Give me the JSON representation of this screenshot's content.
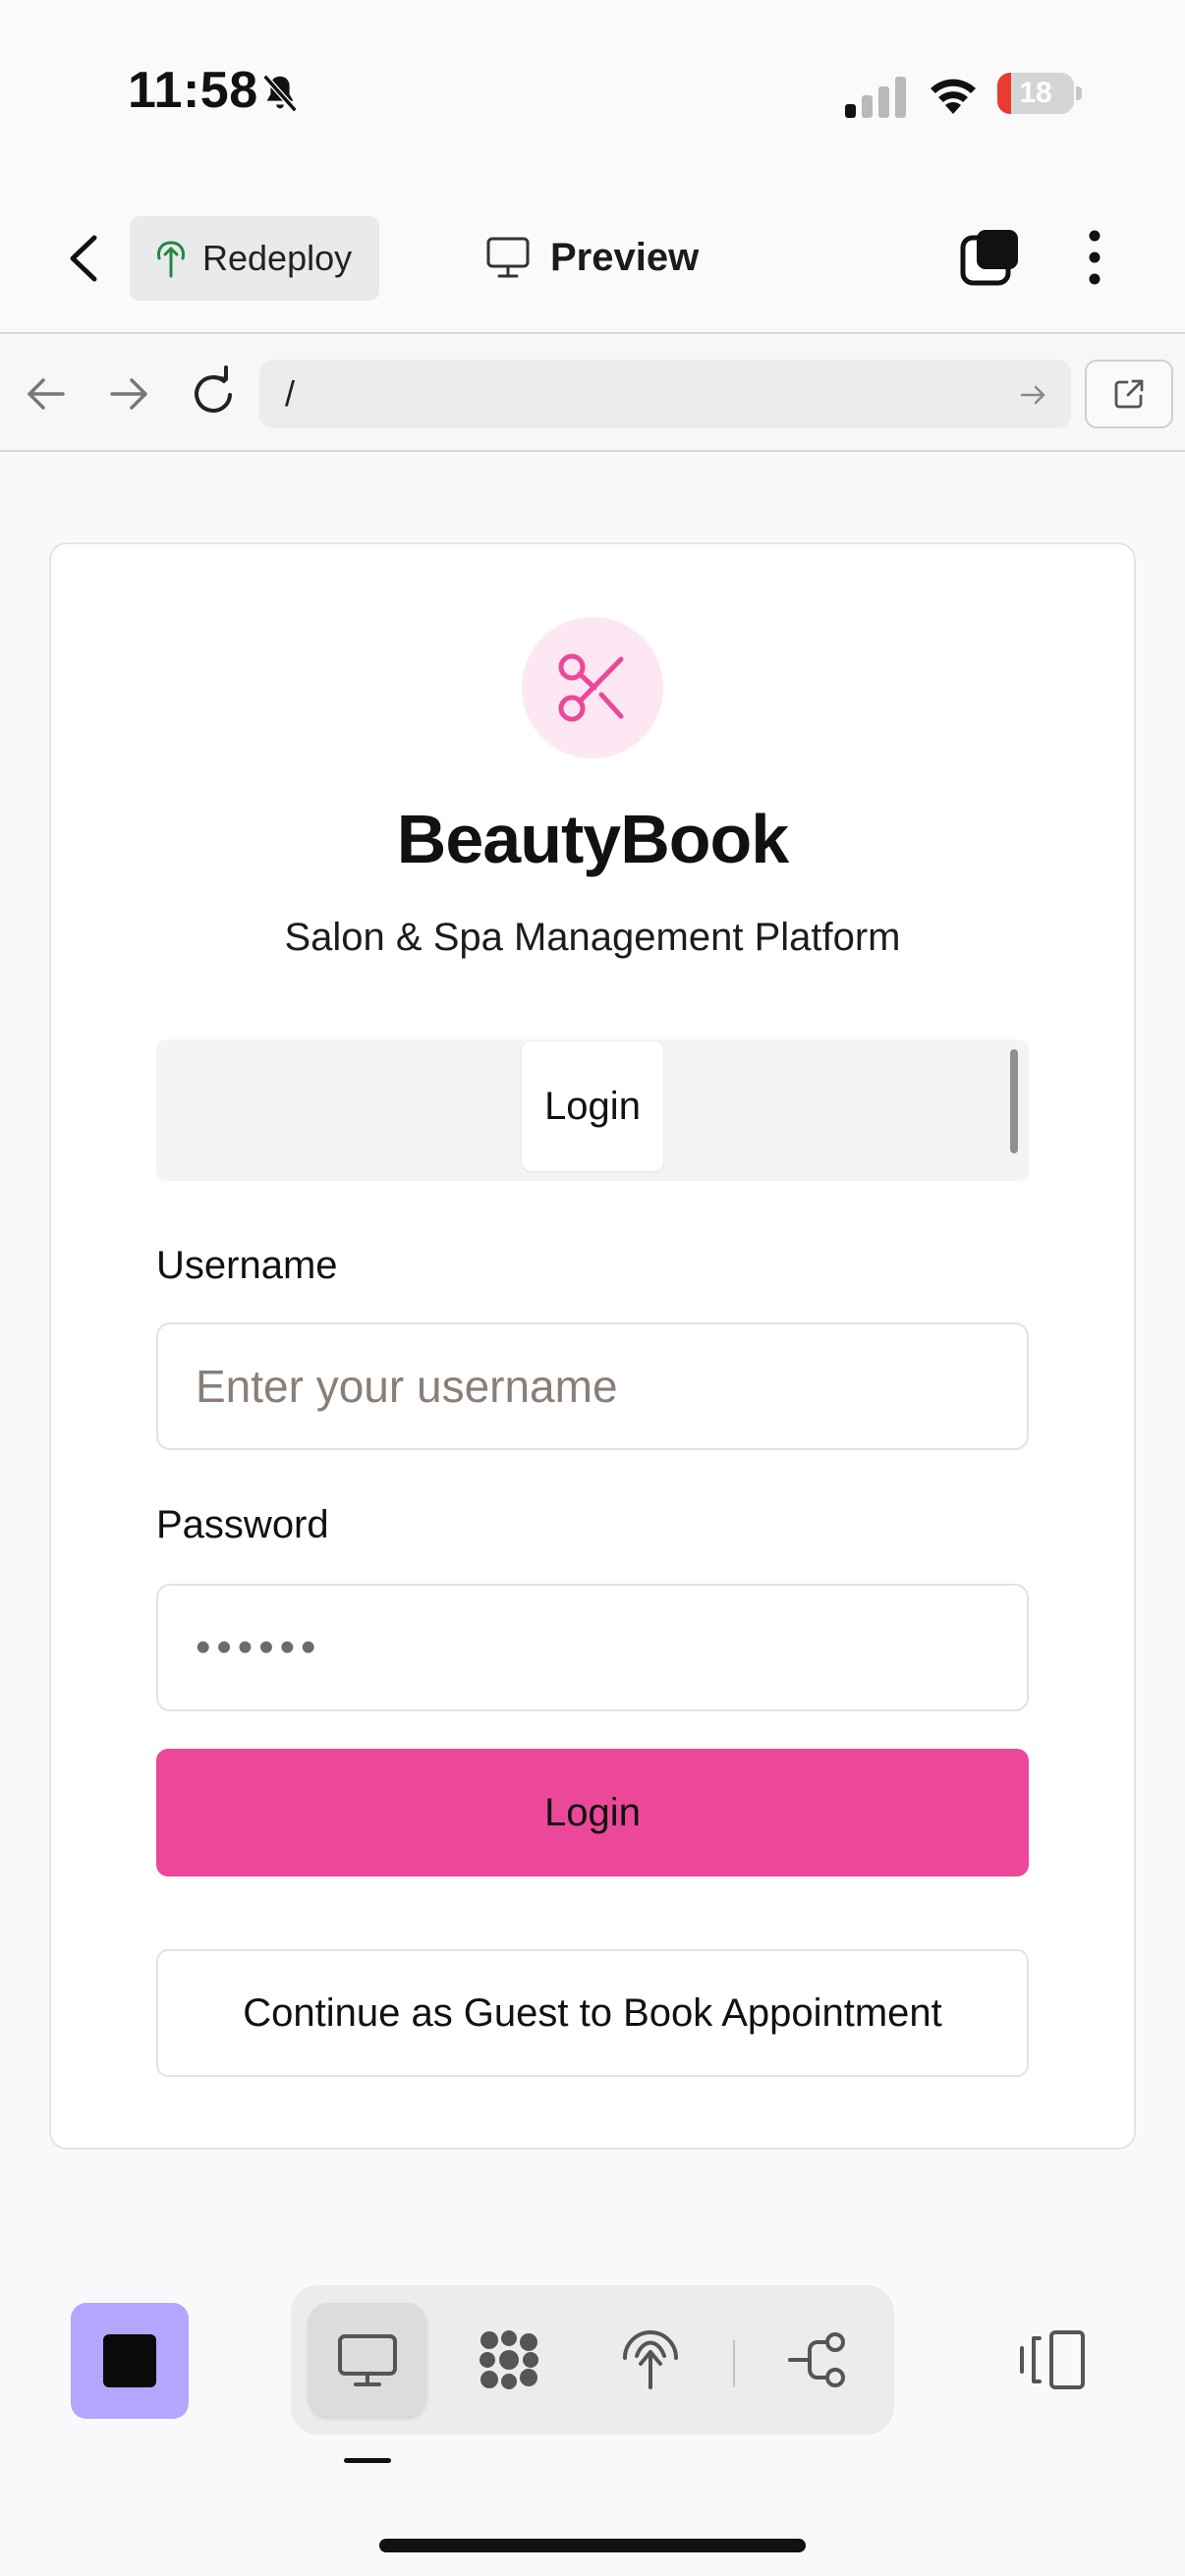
{
  "status_bar": {
    "time": "11:58",
    "battery_level": "18",
    "battery_percent": 18,
    "silent_mode": true
  },
  "toolbar": {
    "redeploy_label": "Redeploy",
    "preview_label": "Preview"
  },
  "browser": {
    "url": "/"
  },
  "login_card": {
    "app_name": "BeautyBook",
    "tagline": "Salon & Spa Management Platform",
    "tabs": [
      {
        "label": "Login",
        "active": true
      }
    ],
    "username": {
      "label": "Username",
      "placeholder": "Enter your username",
      "value": ""
    },
    "password": {
      "label": "Password",
      "value": "••••••"
    },
    "login_button_label": "Login",
    "guest_button_label": "Continue as Guest to Book Appointment"
  },
  "bottom_toolbar": {
    "modes": [
      {
        "icon": "desktop-icon",
        "active": true
      },
      {
        "icon": "apps-icon",
        "active": false
      },
      {
        "icon": "deploy-icon",
        "active": false
      },
      {
        "icon": "git-branch-icon",
        "active": false
      }
    ]
  },
  "colors": {
    "accent_pink": "#ec4899",
    "logo_bg": "#fce7f3",
    "stop_button": "#b3a6ff",
    "battery_low": "#ea3b30"
  }
}
